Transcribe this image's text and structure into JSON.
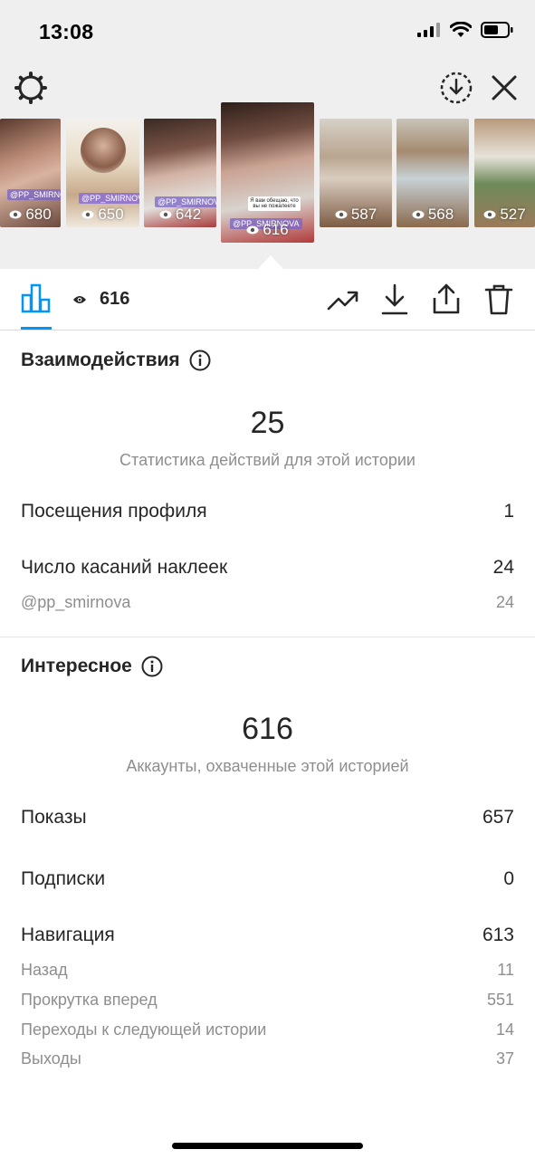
{
  "status_bar": {
    "time": "13:08"
  },
  "thumbnails": [
    {
      "views": "680",
      "tag": "@PP_SMIRNOVA"
    },
    {
      "views": "650",
      "tag": "@PP_SMIRNOVA"
    },
    {
      "views": "642",
      "tag": "@PP_SMIRNOVA"
    },
    {
      "views": "616",
      "tag": "@PP_SMIRNOVA",
      "caption": "Я вам обещаю, что вы не пожалеете"
    },
    {
      "views": "587"
    },
    {
      "views": "568"
    },
    {
      "views": "527"
    }
  ],
  "toolbar": {
    "views_count": "616"
  },
  "interactions": {
    "title": "Взаимодействия",
    "total": "25",
    "caption": "Статистика действий для этой истории",
    "rows": [
      {
        "label": "Посещения профиля",
        "value": "1"
      },
      {
        "label": "Число касаний наклеек",
        "value": "24"
      }
    ],
    "sub_rows": [
      {
        "label": "@pp_smirnova",
        "value": "24"
      }
    ]
  },
  "discovery": {
    "title": "Интересное",
    "total": "616",
    "caption": "Аккаунты, охваченные этой историей",
    "rows": [
      {
        "label": "Показы",
        "value": "657"
      },
      {
        "label": "Подписки",
        "value": "0"
      },
      {
        "label": "Навигация",
        "value": "613"
      }
    ],
    "nav_rows": [
      {
        "label": "Назад",
        "value": "11"
      },
      {
        "label": "Прокрутка вперед",
        "value": "551"
      },
      {
        "label": "Переходы к следующей истории",
        "value": "14"
      },
      {
        "label": "Выходы",
        "value": "37"
      }
    ]
  },
  "icons": {
    "settings": "gear-icon",
    "download_circle": "download-circle-icon",
    "close": "close-icon",
    "stats": "bar-chart-icon",
    "eye": "eye-icon",
    "trend": "trending-up-icon",
    "download": "download-icon",
    "share": "share-icon",
    "delete": "trash-icon",
    "info": "info-icon"
  },
  "colors": {
    "accent": "#0095f6",
    "muted": "#8e8e8e",
    "text": "#262626",
    "top_bg": "#efefef"
  }
}
